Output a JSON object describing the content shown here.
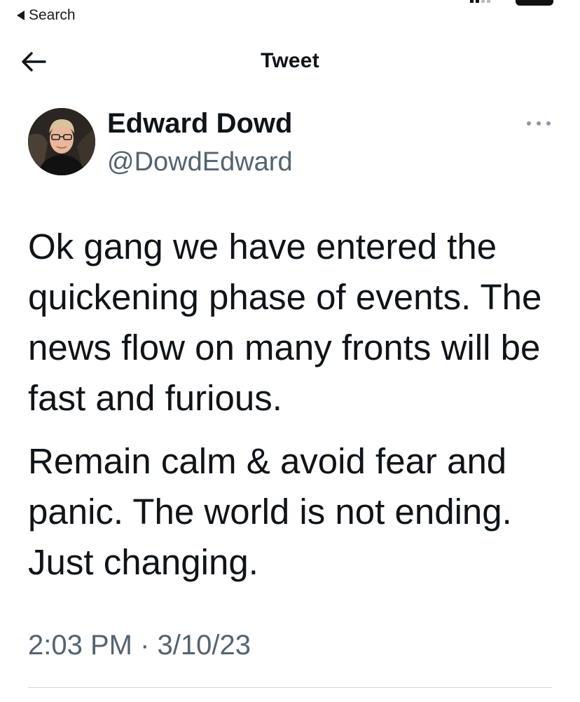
{
  "status_bar": {
    "back_app_label": "Search"
  },
  "nav": {
    "title": "Tweet",
    "back_icon": "arrow-left-icon"
  },
  "author": {
    "name": "Edward Dowd",
    "handle": "@DowdEdward",
    "more_icon": "more-horizontal-icon"
  },
  "tweet": {
    "paragraphs": [
      "Ok gang we have entered the quickening phase of events. The news flow on many fronts will be fast and furious.",
      "Remain calm & avoid fear and panic. The world is not ending. Just changing."
    ],
    "timestamp": "2:03 PM · 3/10/23"
  },
  "colors": {
    "text_primary": "#0f1419",
    "text_secondary": "#536471",
    "divider": "#cfd9de"
  }
}
